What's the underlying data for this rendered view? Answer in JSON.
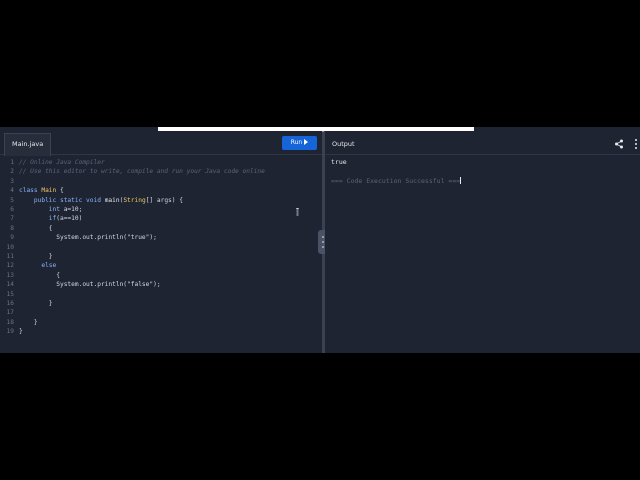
{
  "editor": {
    "tab_label": "Main.java",
    "run_label": "Run",
    "lines": [
      {
        "n": "1",
        "parts": [
          {
            "t": "// Online Java Compiler",
            "c": "cm"
          }
        ]
      },
      {
        "n": "2",
        "parts": [
          {
            "t": "// Use this editor to write, compile and run your Java code online",
            "c": "cm"
          }
        ]
      },
      {
        "n": "3",
        "parts": []
      },
      {
        "n": "4",
        "parts": [
          {
            "t": "class ",
            "c": "kw"
          },
          {
            "t": "Main",
            "c": "ty"
          },
          {
            "t": " {",
            "c": ""
          }
        ]
      },
      {
        "n": "5",
        "parts": [
          {
            "t": "    public static void ",
            "c": "kw"
          },
          {
            "t": "main",
            "c": "fn"
          },
          {
            "t": "(",
            "c": ""
          },
          {
            "t": "String",
            "c": "ty"
          },
          {
            "t": "[] args) {",
            "c": ""
          }
        ]
      },
      {
        "n": "6",
        "parts": [
          {
            "t": "        int ",
            "c": "kw"
          },
          {
            "t": "a=10;",
            "c": ""
          }
        ]
      },
      {
        "n": "7",
        "parts": [
          {
            "t": "        if",
            "c": "kw"
          },
          {
            "t": "(a==10)",
            "c": ""
          }
        ]
      },
      {
        "n": "8",
        "parts": [
          {
            "t": "        {",
            "c": ""
          }
        ]
      },
      {
        "n": "9",
        "parts": [
          {
            "t": "          System.out.println(\"true\");",
            "c": ""
          }
        ]
      },
      {
        "n": "10",
        "parts": []
      },
      {
        "n": "11",
        "parts": [
          {
            "t": "        }",
            "c": ""
          }
        ]
      },
      {
        "n": "12",
        "parts": [
          {
            "t": "      else",
            "c": "kw"
          }
        ]
      },
      {
        "n": "13",
        "parts": [
          {
            "t": "          {",
            "c": ""
          }
        ]
      },
      {
        "n": "14",
        "parts": [
          {
            "t": "          System.out.println(\"false\");",
            "c": ""
          }
        ]
      },
      {
        "n": "15",
        "parts": []
      },
      {
        "n": "16",
        "parts": [
          {
            "t": "        }",
            "c": ""
          }
        ]
      },
      {
        "n": "17",
        "parts": []
      },
      {
        "n": "18",
        "parts": [
          {
            "t": "    }",
            "c": ""
          }
        ]
      },
      {
        "n": "19",
        "parts": [
          {
            "t": "}",
            "c": ""
          }
        ]
      }
    ]
  },
  "output": {
    "title": "Output",
    "result_line": "true",
    "status_line": "=== Code Execution Successful ==="
  },
  "icons": {
    "share": "share-icon",
    "more": "more-vertical-icon",
    "run": "play-icon"
  },
  "colors": {
    "accent": "#1565d8",
    "background": "#1e2432"
  }
}
